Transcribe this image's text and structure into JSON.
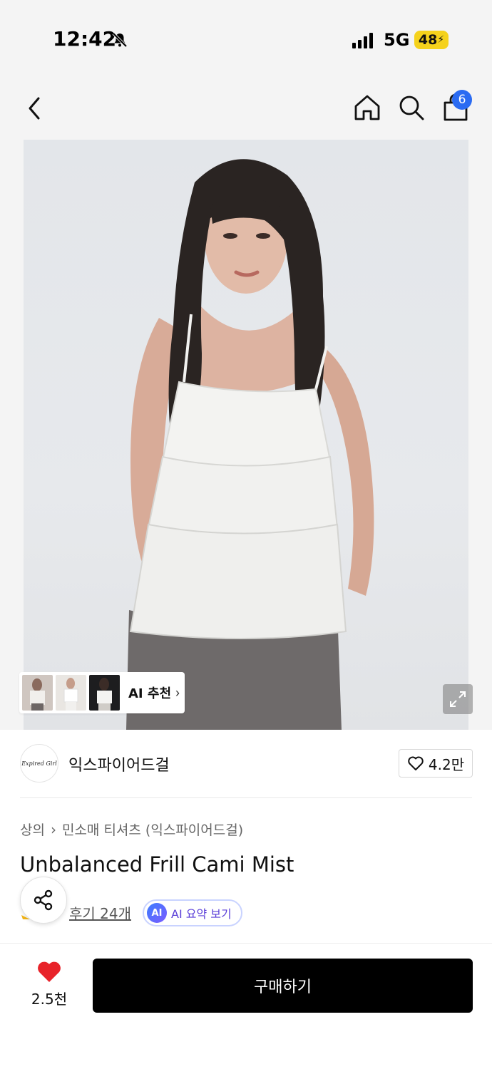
{
  "status_bar": {
    "time": "12:42",
    "network": "5G",
    "battery": "48"
  },
  "nav": {
    "cart_count": "6"
  },
  "hero": {
    "ai_recommend_label": "AI 추천"
  },
  "brand": {
    "name": "익스파이어드걸",
    "logo_text": "Expired Girl",
    "like_count": "4.2만"
  },
  "breadcrumb": {
    "category": "상의",
    "subcategory": "민소매 티셔츠 (익스파이어드걸)"
  },
  "product": {
    "title": "Unbalanced Frill Cami Mist",
    "reviews_label": "후기 24개",
    "ai_summary_label": "AI 요약 보기",
    "ai_badge": "AI"
  },
  "bottom": {
    "wish_count": "2.5천",
    "buy_label": "구매하기"
  },
  "colors": {
    "accent_blue": "#2a6bf2",
    "heart_red": "#e8232a",
    "battery_yellow": "#f5d21c",
    "ai_purple": "#5a3ed8"
  }
}
